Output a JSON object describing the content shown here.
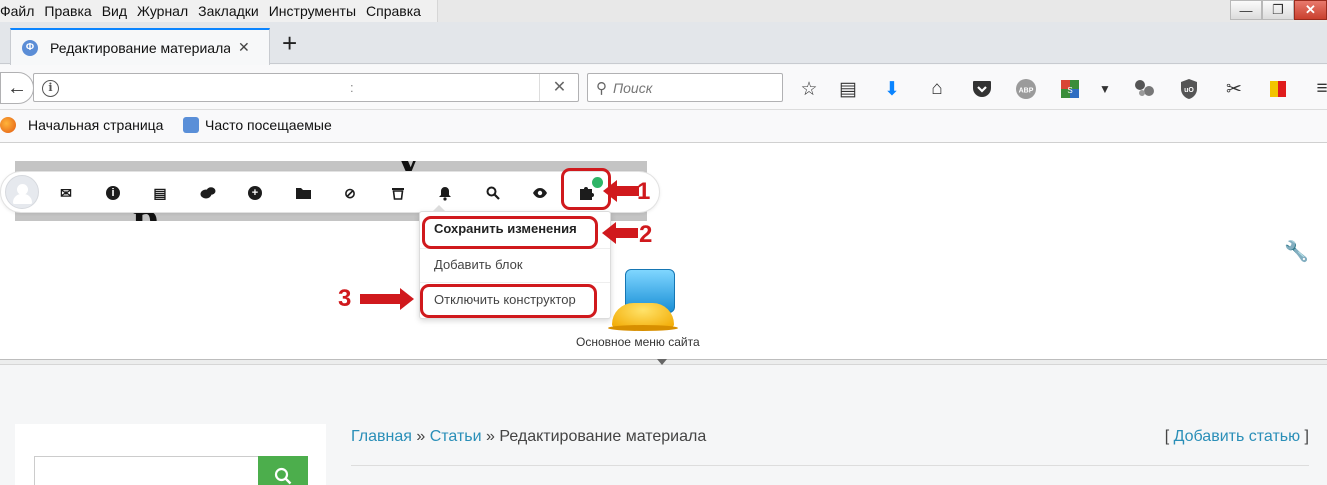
{
  "menubar": {
    "items": [
      "Файл",
      "Правка",
      "Вид",
      "Журнал",
      "Закладки",
      "Инструменты",
      "Справка"
    ],
    "window_buttons": {
      "minimize": "—",
      "maximize": "❐",
      "close": "✕"
    }
  },
  "tab": {
    "title": "Редактирование материала",
    "close": "✕",
    "new_tab": "+"
  },
  "navbar": {
    "url_info": "i",
    "url_text": ":",
    "url_clear": "✕",
    "search_placeholder": "Поиск",
    "search_icon": "🔍",
    "toolbar_icons": [
      "star-icon",
      "reader-icon",
      "download-icon",
      "home-icon",
      "pocket-icon",
      "adblock-icon",
      "extension-icon",
      "dropdown-icon",
      "extensions-icon",
      "ublock-icon",
      "screenshot-icon",
      "flag-icon",
      "menu-icon"
    ]
  },
  "bookmarks": {
    "items": [
      "Начальная страница",
      "Часто посещаемые"
    ]
  },
  "admin": {
    "icons": [
      "mail-icon",
      "info-icon",
      "note-icon",
      "comments-icon",
      "add-icon",
      "folder-icon",
      "blocked-icon",
      "trash-icon",
      "bell-icon",
      "search-icon",
      "eye-icon",
      "puzzle-icon"
    ],
    "menu": {
      "save": "Сохранить изменения",
      "add_block": "Добавить блок",
      "disable": "Отключить конструктор"
    },
    "annotations": {
      "n1": "1",
      "n2": "2",
      "n3": "3"
    }
  },
  "widget": {
    "caption": "Основное меню сайта"
  },
  "breadcrumb": {
    "home": "Главная",
    "sep": " » ",
    "articles": "Статьи",
    "current": "Редактирование материала"
  },
  "add_article": {
    "open": "[ ",
    "label": "Добавить статью",
    "close": " ]"
  },
  "colors": {
    "annotation_red": "#d0191d",
    "link_blue": "#2a8fb8",
    "search_green": "#4cae4c",
    "status_dot": "#2fb567"
  }
}
